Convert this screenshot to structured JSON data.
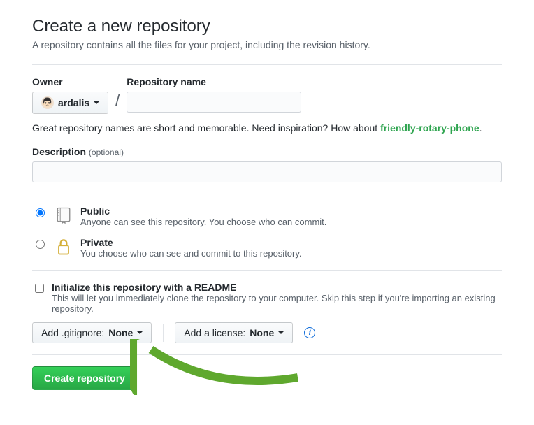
{
  "header": {
    "title": "Create a new repository",
    "subtitle": "A repository contains all the files for your project, including the revision history."
  },
  "owner": {
    "label": "Owner",
    "username": "ardalis"
  },
  "repoName": {
    "label": "Repository name",
    "value": ""
  },
  "hint": {
    "text": "Great repository names are short and memorable. Need inspiration? How about ",
    "suggestion": "friendly-rotary-phone"
  },
  "description": {
    "label": "Description",
    "optional": "(optional)",
    "value": ""
  },
  "visibility": {
    "public": {
      "title": "Public",
      "desc": "Anyone can see this repository. You choose who can commit."
    },
    "private": {
      "title": "Private",
      "desc": "You choose who can see and commit to this repository."
    }
  },
  "readme": {
    "title": "Initialize this repository with a README",
    "desc": "This will let you immediately clone the repository to your computer. Skip this step if you're importing an existing repository."
  },
  "gitignore": {
    "prefix": "Add .gitignore: ",
    "value": "None"
  },
  "license": {
    "prefix": "Add a license: ",
    "value": "None"
  },
  "submit": {
    "label": "Create repository"
  }
}
